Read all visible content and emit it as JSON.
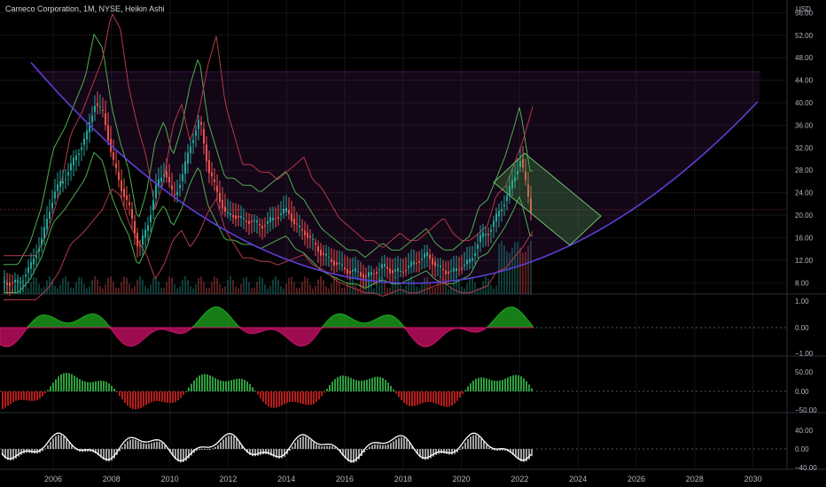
{
  "header": {
    "title": "Cameco Corporation, 1M, NYSE, Heikin Ashi",
    "currency": "USD"
  },
  "colors": {
    "background": "#000000",
    "up": "#26a69a",
    "down": "#ef5350",
    "arc": "#5b3fd6",
    "channel_green": "#4caf50",
    "channel_red": "#b23a48",
    "osc_pos": "#1fa81f",
    "osc_neg": "#d0106a"
  },
  "chart_data": [
    {
      "type": "candlestick",
      "title": "",
      "x_ticks": [
        "2006",
        "2008",
        "2010",
        "2012",
        "2014",
        "2016",
        "2018",
        "2020",
        "2022",
        "2024",
        "2026",
        "2028",
        "2030"
      ],
      "y_ticks": [
        "56.00",
        "52.00",
        "48.00",
        "44.00",
        "40.00",
        "36.00",
        "32.00",
        "28.00",
        "24.00",
        "20.00",
        "16.00",
        "12.00",
        "8.00"
      ],
      "ylim": [
        6,
        57
      ],
      "current_price_line": 21,
      "price_path": {
        "x": [
          2004.8,
          2005.2,
          2005.6,
          2006.0,
          2006.4,
          2006.8,
          2007.1,
          2007.4,
          2007.7,
          2008.0,
          2008.3,
          2008.6,
          2008.9,
          2009.2,
          2009.5,
          2009.8,
          2010.1,
          2010.4,
          2010.7,
          2011.0,
          2011.3,
          2011.6,
          2011.9,
          2012.2,
          2012.5,
          2012.8,
          2013.1,
          2013.4,
          2013.7,
          2014.0,
          2014.3,
          2014.6,
          2014.9,
          2015.2,
          2015.5,
          2015.8,
          2016.1,
          2016.4,
          2016.7,
          2017.0,
          2017.3,
          2017.6,
          2017.9,
          2018.2,
          2018.5,
          2018.8,
          2019.1,
          2019.4,
          2019.7,
          2020.0,
          2020.3,
          2020.6,
          2020.9,
          2021.2,
          2021.5,
          2021.8,
          2022.0,
          2022.2,
          2022.35
        ],
        "close": [
          8,
          11,
          16,
          24,
          27,
          31,
          34,
          40,
          38,
          30,
          25,
          21,
          14,
          18,
          25,
          28,
          23,
          27,
          33,
          37,
          28,
          24,
          20,
          20,
          19,
          19,
          18,
          19,
          20,
          21,
          18,
          17,
          15,
          13,
          12,
          11,
          10,
          10,
          9,
          10,
          11,
          10,
          10,
          11,
          12,
          13,
          11,
          10,
          10,
          11,
          12,
          16,
          17,
          20,
          23,
          27,
          30,
          25,
          21
        ]
      }
    },
    {
      "type": "area",
      "title": "",
      "y_ticks": [
        "1.00",
        "0.00",
        "−1.00"
      ]
    },
    {
      "type": "bar",
      "title": "",
      "y_ticks": [
        "50.00",
        "0.00",
        "−50.00"
      ]
    },
    {
      "type": "bar",
      "title": "",
      "y_ticks": [
        "40.00",
        "0.00",
        "−40.00"
      ]
    }
  ]
}
